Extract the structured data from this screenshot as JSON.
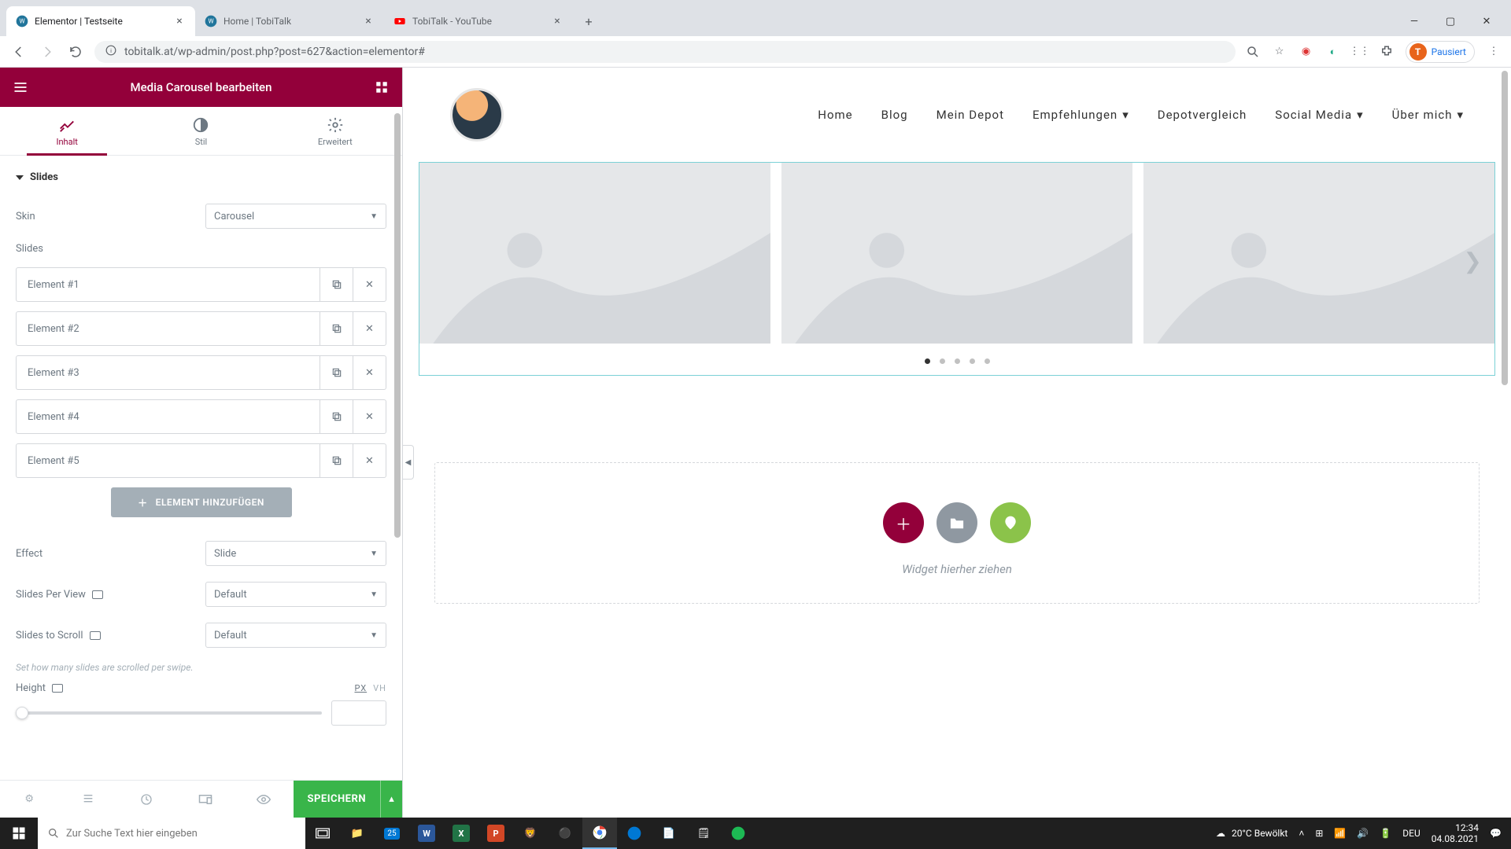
{
  "browser": {
    "tabs": [
      {
        "title": "Elementor | Testseite",
        "favicon": "wp"
      },
      {
        "title": "Home | TobiTalk",
        "favicon": "wp"
      },
      {
        "title": "TobiTalk - YouTube",
        "favicon": "yt"
      }
    ],
    "url": "tobitalk.at/wp-admin/post.php?post=627&action=elementor#",
    "profile_label": "Pausiert",
    "profile_initial": "T"
  },
  "panel": {
    "title": "Media Carousel bearbeiten",
    "tabs": {
      "content": "Inhalt",
      "style": "Stil",
      "advanced": "Erweitert"
    },
    "section_title": "Slides",
    "skin": {
      "label": "Skin",
      "value": "Carousel"
    },
    "slides_label": "Slides",
    "slides": [
      "Element #1",
      "Element #2",
      "Element #3",
      "Element #4",
      "Element #5"
    ],
    "add_button": "ELEMENT HINZUFÜGEN",
    "effect": {
      "label": "Effect",
      "value": "Slide"
    },
    "slides_per_view": {
      "label": "Slides Per View",
      "value": "Default"
    },
    "slides_to_scroll": {
      "label": "Slides to Scroll",
      "value": "Default"
    },
    "hint": "Set how many slides are scrolled per swipe.",
    "height": {
      "label": "Height",
      "units": [
        "PX",
        "VH"
      ]
    },
    "save": "SPEICHERN"
  },
  "site": {
    "menu": [
      "Home",
      "Blog",
      "Mein Depot",
      "Empfehlungen",
      "Depotvergleich",
      "Social Media",
      "Über mich"
    ],
    "menu_dropdown": [
      false,
      false,
      false,
      true,
      false,
      true,
      true
    ],
    "dropzone": "Widget hierher ziehen"
  },
  "taskbar": {
    "search_placeholder": "Zur Suche Text hier eingeben",
    "weather": "20°C  Bewölkt",
    "lang": "DEU",
    "time": "12:34",
    "date": "04.08.2021"
  }
}
